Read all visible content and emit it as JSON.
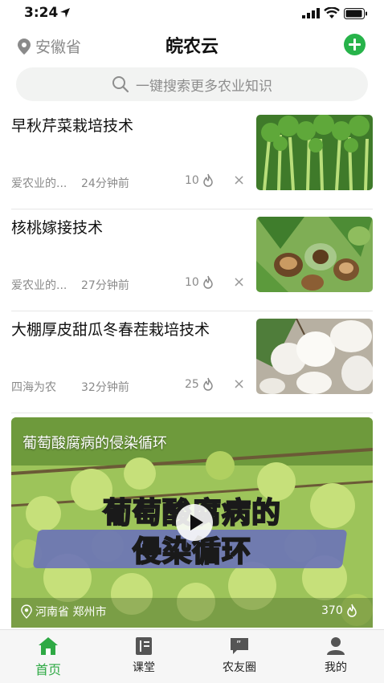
{
  "status_bar": {
    "time": "3:24"
  },
  "header": {
    "location": "安徽省",
    "title": "皖农云"
  },
  "search": {
    "placeholder": "一键搜索更多农业知识"
  },
  "articles": [
    {
      "title": "早秋芹菜栽培技术",
      "source": "爱农业的...",
      "time": "24分钟前",
      "hot": "10",
      "thumb_icon": "celery-photo"
    },
    {
      "title": "核桃嫁接技术",
      "source": "爱农业的...",
      "time": "27分钟前",
      "hot": "10",
      "thumb_icon": "walnut-photo"
    },
    {
      "title": "大棚厚皮甜瓜冬春茬栽培技术",
      "source": "四海为农",
      "time": "32分钟前",
      "hot": "25",
      "thumb_icon": "melon-photo"
    }
  ],
  "video": {
    "title": "葡萄酸腐病的侵染循环",
    "overlay_line1": "葡萄酸腐病的",
    "overlay_line2": "侵染循环",
    "location": "河南省 郑州市",
    "hot": "370"
  },
  "tabs": [
    {
      "label": "首页",
      "icon": "home-icon",
      "active": true
    },
    {
      "label": "课堂",
      "icon": "book-icon",
      "active": false
    },
    {
      "label": "农友圈",
      "icon": "chat-quote-icon",
      "active": false
    },
    {
      "label": "我的",
      "icon": "user-icon",
      "active": false
    }
  ],
  "colors": {
    "accent": "#2ea944",
    "add_button": "#27b34a",
    "muted_text": "#8a8a8a",
    "tabbar_bg": "#f6f6f6"
  },
  "dismiss_symbol": "×"
}
